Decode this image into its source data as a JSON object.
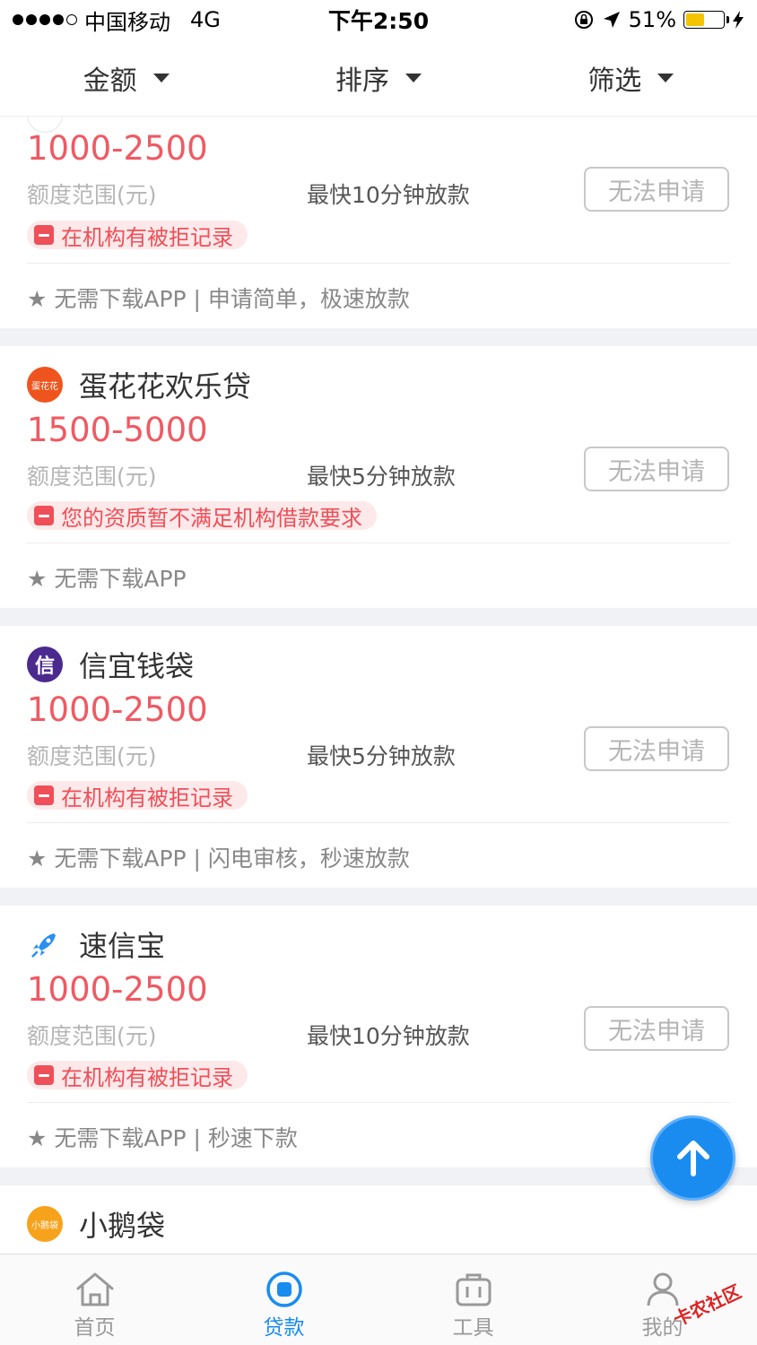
{
  "status": {
    "carrier": "中国移动",
    "network": "4G",
    "time": "下午2:50",
    "battery_pct": "51%",
    "battery_level": 0.51
  },
  "filters": [
    {
      "label": "金额"
    },
    {
      "label": "排序"
    },
    {
      "label": "筛选"
    }
  ],
  "labels": {
    "range_label": "额度范围(元)",
    "apply_label": "无法申请"
  },
  "cards": [
    {
      "name": "",
      "amount": "1000-2500",
      "speed": "最快10分钟放款",
      "reject_reason": "在机构有被拒记录",
      "feature": "★ 无需下载APP | 申请简单，极速放款"
    },
    {
      "name": "蛋花花欢乐贷",
      "logo_text": "蛋花花",
      "amount": "1500-5000",
      "speed": "最快5分钟放款",
      "reject_reason": "您的资质暂不满足机构借款要求",
      "feature": "★ 无需下载APP"
    },
    {
      "name": "信宜钱袋",
      "logo_text": "信",
      "amount": "1000-2500",
      "speed": "最快5分钟放款",
      "reject_reason": "在机构有被拒记录",
      "feature": "★ 无需下载APP | 闪电审核，秒速放款"
    },
    {
      "name": "速信宝",
      "amount": "1000-2500",
      "speed": "最快10分钟放款",
      "reject_reason": "在机构有被拒记录",
      "feature": "★ 无需下载APP | 秒速下款"
    },
    {
      "name": "小鹅袋",
      "logo_text": "小鹅袋"
    }
  ],
  "tabs": [
    {
      "label": "首页"
    },
    {
      "label": "贷款"
    },
    {
      "label": "工具"
    },
    {
      "label": "我的"
    }
  ],
  "watermark": "卡农社区",
  "colors": {
    "accent": "#1a8cf0",
    "amount": "#ef5a63",
    "reject": "#ee4f58"
  }
}
